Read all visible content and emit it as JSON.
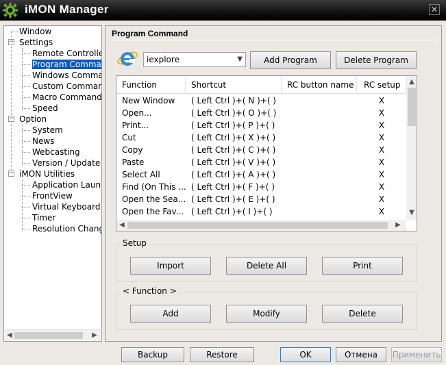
{
  "window": {
    "title": "iMON Manager",
    "close_glyph": "✕"
  },
  "tree": {
    "nodes": [
      {
        "label": "Window"
      },
      {
        "label": "Settings"
      },
      {
        "label": "Remote Controller"
      },
      {
        "label": "Program Command"
      },
      {
        "label": "Windows Command"
      },
      {
        "label": "Custom Command"
      },
      {
        "label": "Macro Command"
      },
      {
        "label": "Speed"
      },
      {
        "label": "Option"
      },
      {
        "label": "System"
      },
      {
        "label": "News"
      },
      {
        "label": "Webcasting"
      },
      {
        "label": "Version / Update"
      },
      {
        "label": "iMON Utilities"
      },
      {
        "label": "Application Launcher"
      },
      {
        "label": "FrontView"
      },
      {
        "label": "Virtual Keyboard"
      },
      {
        "label": "Timer"
      },
      {
        "label": "Resolution Changer"
      }
    ],
    "selected": "Program Command"
  },
  "panel": {
    "title": "Program Command",
    "program_select": "iexplore",
    "add_program": "Add Program",
    "delete_program": "Delete Program"
  },
  "table": {
    "columns": [
      "Function",
      "Shortcut",
      "RC button name",
      "RC setup"
    ],
    "rows": [
      {
        "function": "New Window",
        "shortcut": "( Left Ctrl )+( N )+(  )",
        "rc_name": "",
        "rc_setup": "X"
      },
      {
        "function": "Open...",
        "shortcut": "( Left Ctrl )+( O )+(  )",
        "rc_name": "",
        "rc_setup": "X"
      },
      {
        "function": "Print...",
        "shortcut": "( Left Ctrl )+( P )+(  )",
        "rc_name": "",
        "rc_setup": "X"
      },
      {
        "function": "Cut",
        "shortcut": "( Left Ctrl )+( X )+(  )",
        "rc_name": "",
        "rc_setup": "X"
      },
      {
        "function": "Copy",
        "shortcut": "( Left Ctrl )+( C )+(  )",
        "rc_name": "",
        "rc_setup": "X"
      },
      {
        "function": "Paste",
        "shortcut": "( Left Ctrl )+( V )+(  )",
        "rc_name": "",
        "rc_setup": "X"
      },
      {
        "function": "Select All",
        "shortcut": "( Left Ctrl )+( A )+(  )",
        "rc_name": "",
        "rc_setup": "X"
      },
      {
        "function": "Find (On This ...",
        "shortcut": "( Left Ctrl )+( F )+(  )",
        "rc_name": "",
        "rc_setup": "X"
      },
      {
        "function": "Open the Sea...",
        "shortcut": "( Left Ctrl )+( E )+(  )",
        "rc_name": "",
        "rc_setup": "X"
      },
      {
        "function": "Open the Fav...",
        "shortcut": "( Left Ctrl )+( I )+(  )",
        "rc_name": "",
        "rc_setup": "X"
      }
    ]
  },
  "setup": {
    "legend": "Setup",
    "import": "Import",
    "delete_all": "Delete All",
    "print": "Print"
  },
  "function_group": {
    "legend": "< Function >",
    "add": "Add",
    "modify": "Modify",
    "delete": "Delete"
  },
  "footer": {
    "backup": "Backup",
    "restore": "Restore",
    "ok": "OK",
    "cancel": "Отмена",
    "apply": "Применить"
  },
  "colors": {
    "selection": "#0a58c8",
    "titlebar": "#111111",
    "logo": "#6fae2a"
  }
}
